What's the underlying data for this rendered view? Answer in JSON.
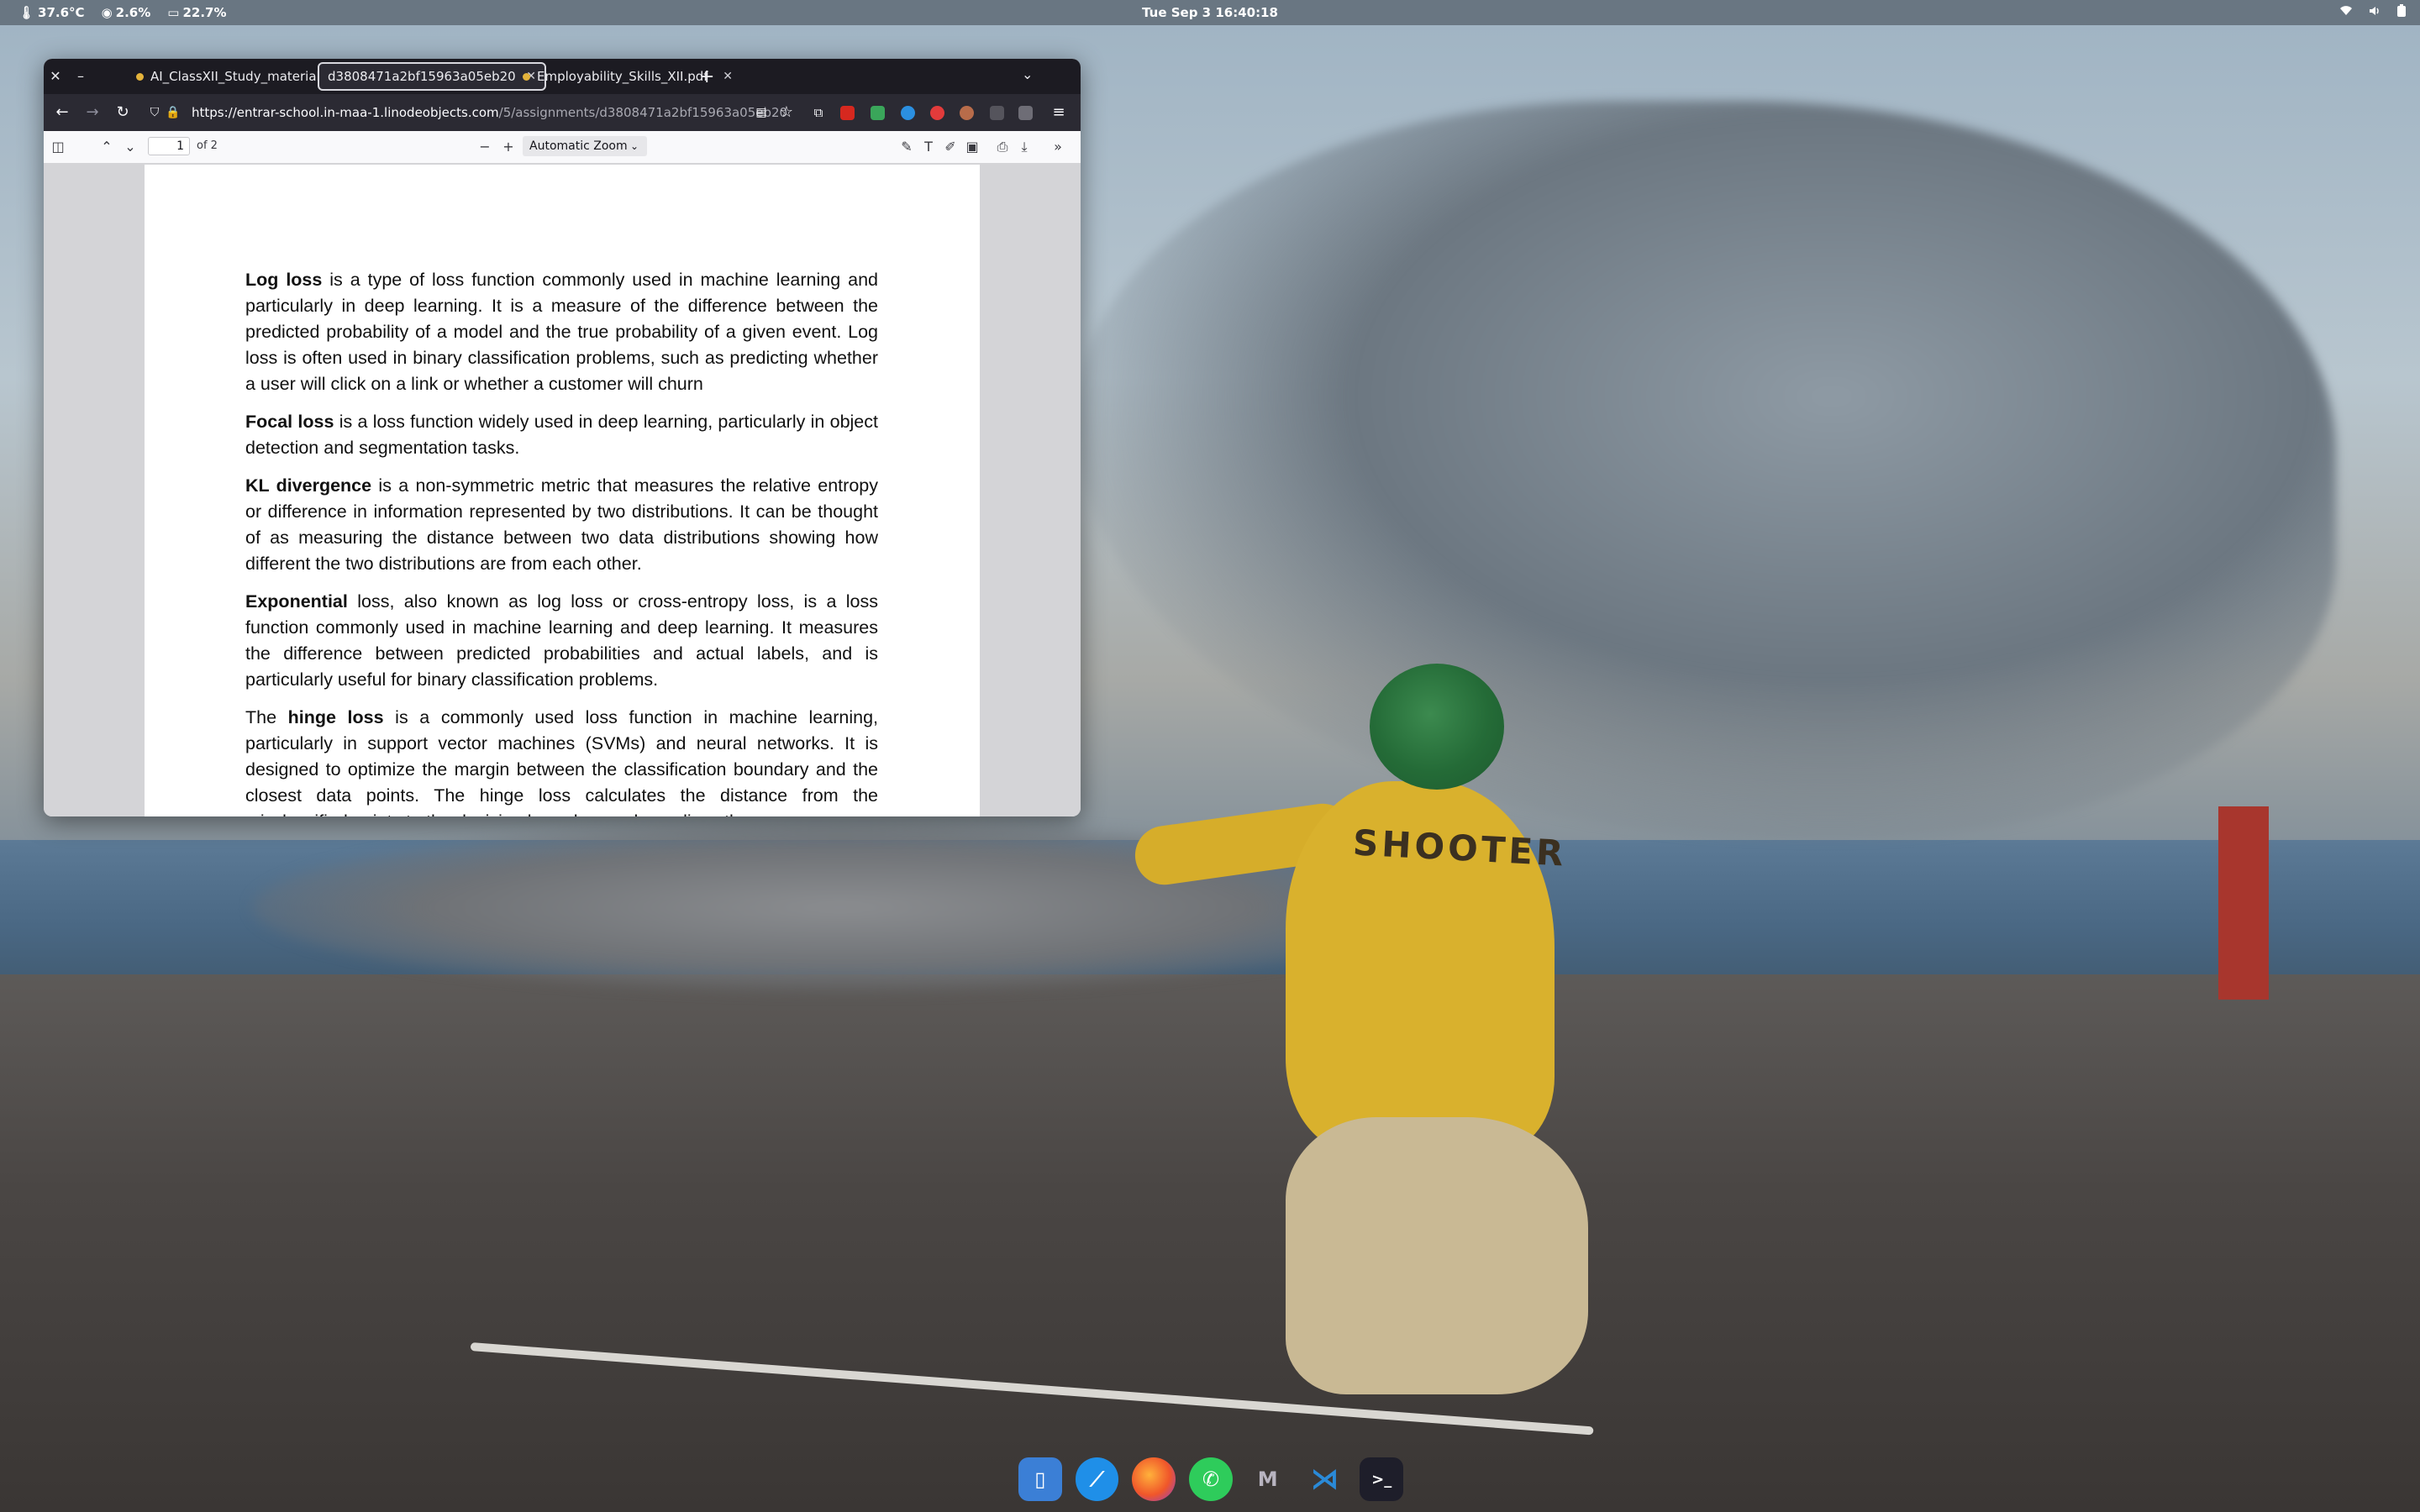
{
  "topbar": {
    "temp": "37.6°C",
    "cpu": "2.6%",
    "mem": "22.7%",
    "clock": "Tue Sep 3  16:40:18",
    "icons": [
      "wifi-icon",
      "volume-icon",
      "battery-icon"
    ]
  },
  "browser": {
    "tabs": [
      {
        "title": "AI_ClassXII_Study_material",
        "active": false
      },
      {
        "title": "d3808471a2bf15963a05eb20",
        "active": true
      },
      {
        "title": "Employability_Skills_XII.pdf",
        "active": false
      }
    ],
    "url_host": "https://entrar-school.in-maa-1.linodeobjects.com",
    "url_path": "/5/assignments/d3808471a2bf15963a05eb20",
    "extension_icons": [
      "ublock-icon",
      "green-ext-icon",
      "blue-ext-icon",
      "s-ext-icon",
      "profile-ext-icon",
      "glasses-ext-icon",
      "help-ext-icon"
    ]
  },
  "pdf": {
    "page_current": "1",
    "page_count": "of 2",
    "zoom": "Automatic Zoom",
    "paragraphs": [
      {
        "bold": "Log loss",
        "pre": "",
        "text": " is a type of loss function commonly used in machine learning and particularly in deep learning. It is a measure of the difference between the predicted probability of a model and the true probability of a given event. Log loss is often used in binary classification problems, such as predicting whether a user will click on a link or whether a customer will churn"
      },
      {
        "bold": "Focal loss",
        "pre": "",
        "text": " is a loss function widely used in deep learning, particularly in object detection and segmentation tasks."
      },
      {
        "bold": "KL divergence",
        "pre": "",
        "text": " is a non-symmetric metric that measures the relative entropy or difference in information represented by two distributions. It can be thought of as measuring the distance between two data distributions showing how different the two distributions are from each other."
      },
      {
        "bold": "Exponential",
        "pre": "",
        "text": " loss, also known as log loss or cross-entropy loss, is a loss function commonly used in machine learning and deep learning. It measures the difference between predicted probabilities and actual labels, and is particularly useful for binary classification problems."
      },
      {
        "bold": "hinge loss",
        "pre": "The ",
        "text": " is a commonly used loss function in machine learning, particularly in support vector machines (SVMs) and neural networks. It is designed to optimize the margin between the classification boundary and the closest data points. The hinge loss calculates the distance from the misclassified points to the decision boundary and penalizes these errors."
      }
    ]
  },
  "wallpaper": {
    "shooter_text": "SHOOTER"
  },
  "dock": {
    "items": [
      "files-icon",
      "safari-icon",
      "firefox-icon",
      "whatsapp-icon",
      "app-m-icon",
      "vscode-icon",
      "terminal-icon"
    ]
  },
  "colors": {
    "tabbar": "#1c1b22",
    "navbar": "#2b2a33",
    "viewer_bg": "#d4d4d7"
  }
}
